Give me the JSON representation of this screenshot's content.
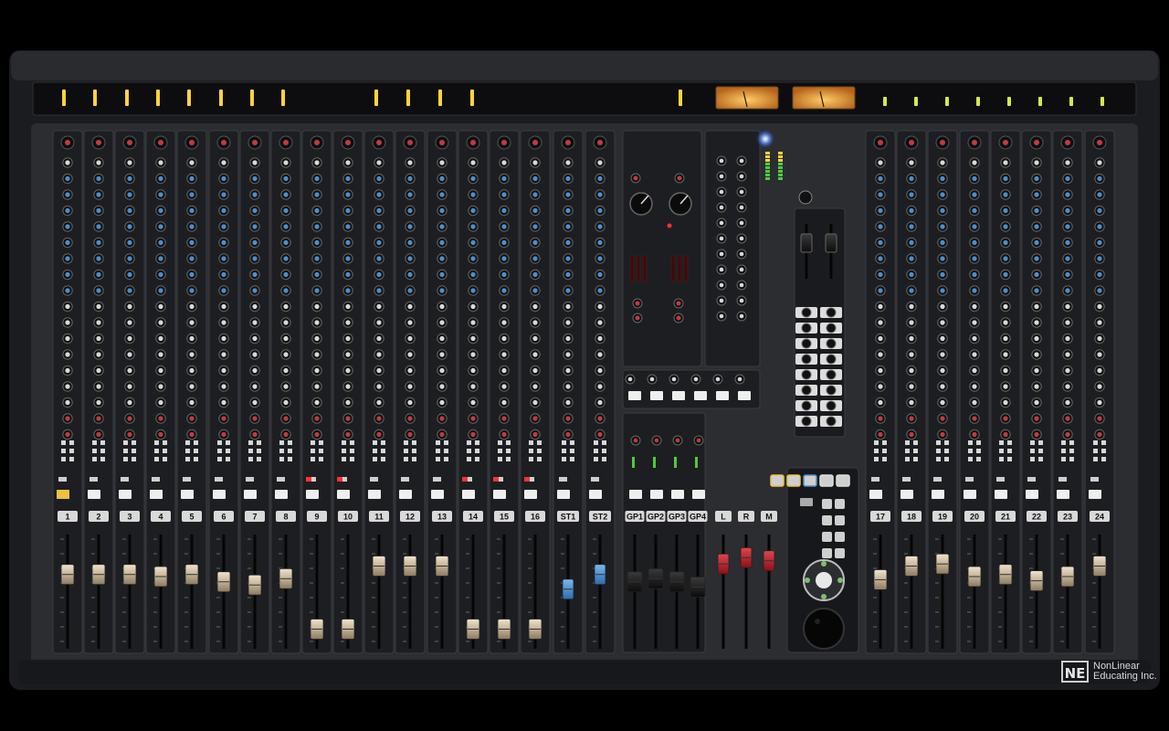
{
  "console": {
    "channels": [
      "1",
      "2",
      "3",
      "4",
      "5",
      "6",
      "7",
      "8",
      "9",
      "10",
      "11",
      "12",
      "13",
      "14",
      "15",
      "16"
    ],
    "stereo_channels": [
      "ST1",
      "ST2"
    ],
    "groups": [
      "GP1",
      "GP2",
      "GP3",
      "GP4"
    ],
    "masters": [
      "L",
      "R",
      "M"
    ],
    "right_channels": [
      "17",
      "18",
      "19",
      "20",
      "21",
      "22",
      "23",
      "24"
    ],
    "colors": {
      "panel": "#2b2d31",
      "strip": "#1c1d20",
      "meter_on": "#ffd43b",
      "cap_default": "#c9b79a",
      "cap_stereo": "#3f8fd8",
      "cap_master": "#c0222a",
      "cap_group": "#1a1a1a"
    },
    "fader_levels": {
      "channels": [
        0.62,
        0.62,
        0.62,
        0.6,
        0.62,
        0.55,
        0.52,
        0.58,
        0.1,
        0.1,
        0.7,
        0.7,
        0.7,
        0.1,
        0.1,
        0.1
      ],
      "stereo": [
        0.48,
        0.62
      ],
      "groups": [
        0.55,
        0.58,
        0.55,
        0.5
      ],
      "masters": [
        0.72,
        0.78,
        0.75
      ],
      "right_channels": [
        0.57,
        0.7,
        0.72,
        0.6,
        0.62,
        0.56,
        0.6,
        0.7
      ]
    }
  },
  "branding": {
    "logo": "NE",
    "line1": "NonLinear",
    "line2": "Educating Inc."
  }
}
